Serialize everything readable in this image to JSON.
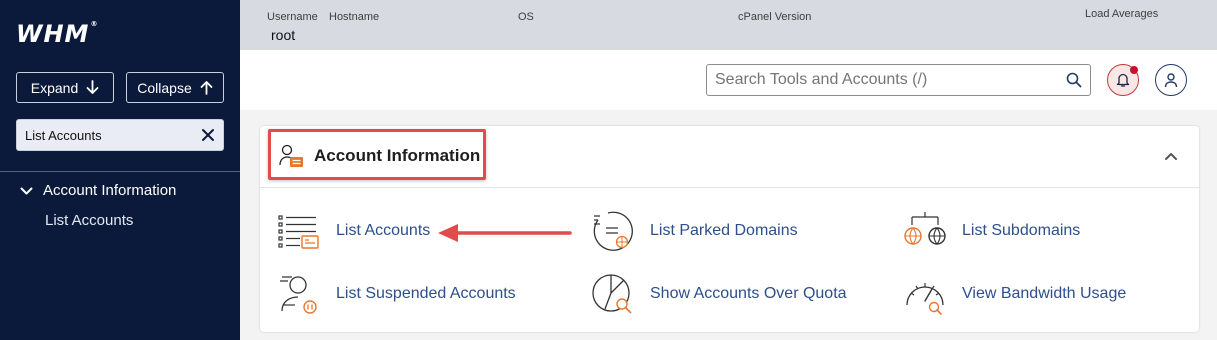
{
  "sidebar": {
    "logo": "WHM",
    "logo_reg": "®",
    "expand_label": "Expand",
    "collapse_label": "Collapse",
    "filter_value": "List Accounts",
    "category_label": "Account Information",
    "item_label": "List Accounts"
  },
  "header": {
    "username_label": "Username",
    "username_value": "root",
    "hostname_label": "Hostname",
    "os_label": "OS",
    "cpanel_version_label": "cPanel Version",
    "load_averages_label": "Load Averages"
  },
  "search": {
    "placeholder": "Search Tools and Accounts (/)"
  },
  "panel": {
    "title": "Account Information",
    "tools": [
      {
        "label": "List Accounts",
        "icon": "list-accounts-icon"
      },
      {
        "label": "List Parked Domains",
        "icon": "parked-domains-icon"
      },
      {
        "label": "List Subdomains",
        "icon": "subdomains-icon"
      },
      {
        "label": "List Suspended Accounts",
        "icon": "suspended-accounts-icon"
      },
      {
        "label": "Show Accounts Over Quota",
        "icon": "over-quota-icon"
      },
      {
        "label": "View Bandwidth Usage",
        "icon": "bandwidth-icon"
      }
    ]
  },
  "colors": {
    "sidebar_bg": "#0b1a3a",
    "link": "#2d4f8c",
    "accent_orange": "#e8772e",
    "highlight_red": "#e04b4b"
  }
}
